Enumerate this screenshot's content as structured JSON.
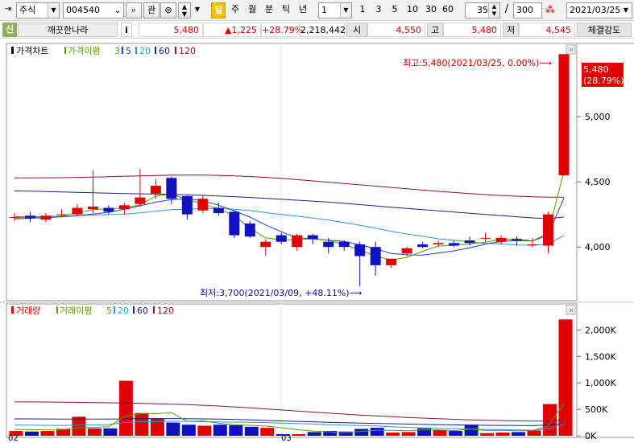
{
  "toolbar": {
    "market": "주식",
    "code": "004540",
    "btn_gwan": "관",
    "periods": [
      "일",
      "주",
      "월",
      "분",
      "틱",
      "년"
    ],
    "active_period": "일",
    "interval_value": "1",
    "intervals": [
      "1",
      "3",
      "5",
      "10",
      "30",
      "60"
    ],
    "visible_count": "35",
    "slash": "/",
    "total_count": "300",
    "date": "2021/03/25"
  },
  "stock": {
    "badge": "신",
    "name": "깨끗한나라",
    "info_btn": "i",
    "price": "5,480",
    "change": "▲1,225",
    "change_pct": "+28.79%",
    "volume": "2,218,442",
    "open_label": "시",
    "open": "4,550",
    "high_label": "고",
    "high": "5,480",
    "low_label": "저",
    "low": "4,545",
    "strength_label": "체결강도"
  },
  "colors": {
    "up": "#e00000",
    "down": "#1010c0",
    "ma3": "#5aa000",
    "ma5": "#1a40d0",
    "ma20": "#2a9ad0",
    "ma60": "#202080",
    "ma120": "#8a1040"
  },
  "chart_data": [
    {
      "type": "candlestick",
      "legend": [
        "가격차트",
        "가격이평",
        "3",
        "5",
        "20",
        "60",
        "120"
      ],
      "y_ticks": [
        "5,000",
        "4,500",
        "4,000"
      ],
      "y_tick_values": [
        5000,
        4500,
        4000
      ],
      "ylim": [
        3600,
        5550
      ],
      "x_labels": [
        "02",
        "03"
      ],
      "current_label": "5,480",
      "current_pct": "(28.79%)",
      "annotation_high": "최고:5,480(2021/03/25, 0.00%)⟶",
      "annotation_low": "최저:3,700(2021/03/09, +48.11%)⟶",
      "candles": [
        {
          "o": 4230,
          "h": 4260,
          "l": 4200,
          "c": 4230
        },
        {
          "o": 4240,
          "h": 4270,
          "l": 4190,
          "c": 4220
        },
        {
          "o": 4210,
          "h": 4260,
          "l": 4190,
          "c": 4240
        },
        {
          "o": 4250,
          "h": 4290,
          "l": 4230,
          "c": 4250
        },
        {
          "o": 4250,
          "h": 4330,
          "l": 4240,
          "c": 4300
        },
        {
          "o": 4290,
          "h": 4590,
          "l": 4260,
          "c": 4310
        },
        {
          "o": 4300,
          "h": 4320,
          "l": 4250,
          "c": 4270
        },
        {
          "o": 4290,
          "h": 4340,
          "l": 4250,
          "c": 4320
        },
        {
          "o": 4330,
          "h": 4600,
          "l": 4310,
          "c": 4380
        },
        {
          "o": 4410,
          "h": 4520,
          "l": 4370,
          "c": 4470
        },
        {
          "o": 4530,
          "h": 4540,
          "l": 4330,
          "c": 4370
        },
        {
          "o": 4390,
          "h": 4400,
          "l": 4210,
          "c": 4250
        },
        {
          "o": 4280,
          "h": 4400,
          "l": 4260,
          "c": 4370
        },
        {
          "o": 4300,
          "h": 4340,
          "l": 4240,
          "c": 4260
        },
        {
          "o": 4270,
          "h": 4280,
          "l": 4070,
          "c": 4090
        },
        {
          "o": 4180,
          "h": 4200,
          "l": 4070,
          "c": 4080
        },
        {
          "o": 4000,
          "h": 4060,
          "l": 3930,
          "c": 4040
        },
        {
          "o": 4090,
          "h": 4110,
          "l": 4020,
          "c": 4040
        },
        {
          "o": 4000,
          "h": 4100,
          "l": 3970,
          "c": 4090
        },
        {
          "o": 4090,
          "h": 4100,
          "l": 4020,
          "c": 4060
        },
        {
          "o": 4040,
          "h": 4070,
          "l": 3950,
          "c": 4000
        },
        {
          "o": 4040,
          "h": 4050,
          "l": 3970,
          "c": 4000
        },
        {
          "o": 4020,
          "h": 4040,
          "l": 3700,
          "c": 3930
        },
        {
          "o": 4000,
          "h": 4040,
          "l": 3780,
          "c": 3860
        },
        {
          "o": 3860,
          "h": 3910,
          "l": 3840,
          "c": 3910
        },
        {
          "o": 3950,
          "h": 4000,
          "l": 3930,
          "c": 3990
        },
        {
          "o": 4020,
          "h": 4040,
          "l": 3990,
          "c": 4000
        },
        {
          "o": 4020,
          "h": 4050,
          "l": 4000,
          "c": 4030
        },
        {
          "o": 4030,
          "h": 4050,
          "l": 4000,
          "c": 4010
        },
        {
          "o": 4050,
          "h": 4080,
          "l": 4010,
          "c": 4030
        },
        {
          "o": 4070,
          "h": 4110,
          "l": 4040,
          "c": 4070
        },
        {
          "o": 4040,
          "h": 4090,
          "l": 4020,
          "c": 4070
        },
        {
          "o": 4060,
          "h": 4080,
          "l": 4010,
          "c": 4050
        },
        {
          "o": 4020,
          "h": 4070,
          "l": 4000,
          "c": 4020
        },
        {
          "o": 4010,
          "h": 4270,
          "l": 3950,
          "c": 4250
        },
        {
          "o": 4550,
          "h": 5480,
          "l": 4545,
          "c": 5480
        }
      ],
      "ma3": [
        4225,
        4228,
        4230,
        4237,
        4263,
        4287,
        4293,
        4300,
        4323,
        4390,
        4407,
        4363,
        4330,
        4293,
        4240,
        4143,
        4070,
        4053,
        4057,
        4063,
        4050,
        4020,
        3977,
        3930,
        3900,
        3920,
        3967,
        4007,
        4013,
        4023,
        4037,
        4057,
        4063,
        4047,
        4107,
        4580
      ],
      "ma5": [
        4215,
        4220,
        4225,
        4232,
        4239,
        4253,
        4266,
        4290,
        4316,
        4344,
        4364,
        4370,
        4356,
        4320,
        4278,
        4229,
        4169,
        4117,
        4070,
        4063,
        4052,
        4043,
        4018,
        3986,
        3950,
        3940,
        3938,
        3953,
        3970,
        3994,
        4022,
        4042,
        4048,
        4046,
        4091,
        4377
      ],
      "ma20": [
        4232,
        4233,
        4234,
        4236,
        4240,
        4245,
        4248,
        4253,
        4262,
        4275,
        4286,
        4290,
        4296,
        4296,
        4289,
        4280,
        4264,
        4250,
        4236,
        4222,
        4207,
        4187,
        4167,
        4145,
        4120,
        4100,
        4082,
        4063,
        4052,
        4039,
        4027,
        4022,
        4016,
        4012,
        4022,
        4088
      ],
      "ma60": [
        4430,
        4428,
        4425,
        4422,
        4419,
        4416,
        4413,
        4410,
        4408,
        4406,
        4404,
        4400,
        4396,
        4392,
        4386,
        4380,
        4373,
        4366,
        4359,
        4352,
        4344,
        4335,
        4325,
        4315,
        4305,
        4296,
        4286,
        4277,
        4268,
        4259,
        4250,
        4241,
        4232,
        4223,
        4217,
        4230
      ],
      "ma120": [
        4530,
        4530,
        4531,
        4532,
        4534,
        4536,
        4539,
        4542,
        4546,
        4549,
        4551,
        4552,
        4552,
        4550,
        4546,
        4541,
        4534,
        4526,
        4517,
        4507,
        4497,
        4487,
        4477,
        4467,
        4457,
        4447,
        4437,
        4427,
        4418,
        4410,
        4402,
        4395,
        4390,
        4385,
        4382,
        4382
      ]
    },
    {
      "type": "bar",
      "legend": [
        "거래량",
        "거래이평",
        "5",
        "20",
        "60",
        "120"
      ],
      "y_ticks": [
        "2,000K",
        "1,500K",
        "1,000K",
        "500K",
        "0K"
      ],
      "y_tick_values": [
        2000,
        1500,
        1000,
        500,
        0
      ],
      "ylim": [
        0,
        2250
      ],
      "values": [
        90,
        80,
        90,
        130,
        360,
        140,
        140,
        1040,
        430,
        330,
        250,
        210,
        190,
        210,
        200,
        170,
        150,
        30,
        30,
        70,
        90,
        80,
        130,
        150,
        60,
        70,
        140,
        110,
        90,
        210,
        50,
        60,
        70,
        100,
        600,
        2200
      ],
      "ma5": [
        120,
        115,
        110,
        112,
        150,
        160,
        172,
        362,
        422,
        418,
        438,
        272,
        282,
        238,
        210,
        198,
        184,
        152,
        116,
        90,
        74,
        60,
        80,
        104,
        102,
        96,
        110,
        110,
        98,
        124,
        100,
        102,
        96,
        98,
        182,
        610
      ],
      "ma20": [
        200,
        200,
        198,
        196,
        200,
        205,
        208,
        250,
        265,
        270,
        275,
        272,
        266,
        262,
        258,
        255,
        250,
        240,
        232,
        222,
        210,
        200,
        192,
        185,
        172,
        160,
        150,
        142,
        135,
        128,
        120,
        118,
        110,
        105,
        130,
        220
      ],
      "ma60": [
        320,
        320,
        318,
        316,
        315,
        314,
        314,
        320,
        325,
        326,
        326,
        324,
        320,
        316,
        310,
        300,
        290,
        280,
        272,
        264,
        256,
        248,
        240,
        234,
        228,
        222,
        216,
        210,
        206,
        202,
        198,
        196,
        194,
        192,
        200,
        230
      ],
      "ma120": [
        640,
        640,
        638,
        636,
        632,
        628,
        624,
        620,
        614,
        606,
        598,
        588,
        576,
        562,
        546,
        528,
        508,
        488,
        468,
        448,
        428,
        410,
        392,
        376,
        360,
        346,
        334,
        322,
        312,
        302,
        294,
        287,
        282,
        278,
        278,
        290
      ]
    }
  ]
}
